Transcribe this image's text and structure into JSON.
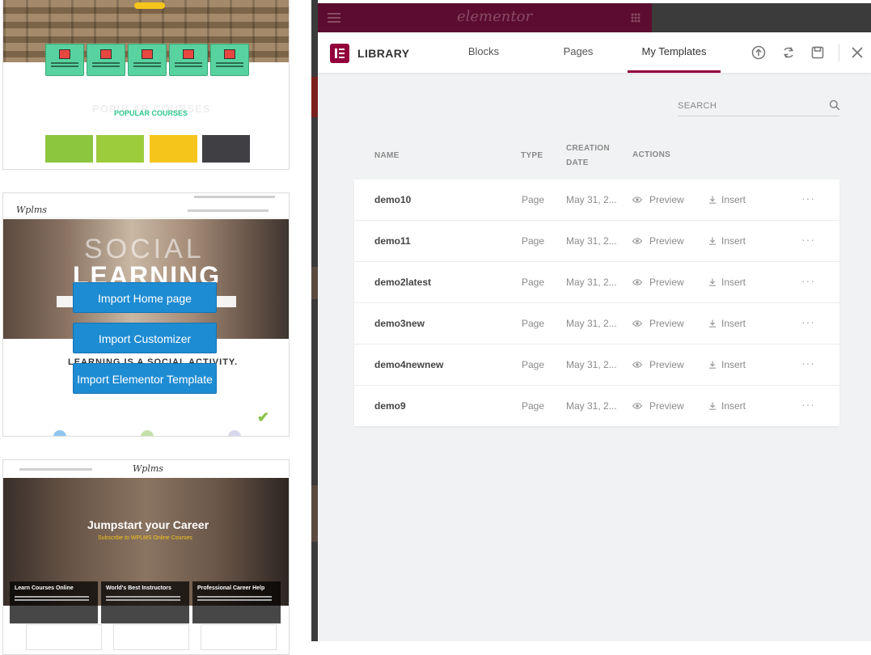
{
  "left_demos": {
    "card1": {
      "popular_ghost": "POPULAR COURSES",
      "popular_label": "POPULAR COURSES"
    },
    "card2": {
      "logo": "Wplms",
      "hero_line1": "SOCIAL",
      "hero_line2": "LEARNING",
      "tagline": "LEARNING IS A SOCIAL ACTIVITY.",
      "buttons": [
        "Import Home page",
        "Import Customizer",
        "Import Elementor Template"
      ]
    },
    "card3": {
      "logo": "Wplms",
      "hero_title": "Jumpstart your Career",
      "hero_sub": "Subscribe to WPLMS Online Courses",
      "boxes": [
        "Learn Courses Online",
        "World's Best Instructors",
        "Professional Career Help"
      ]
    }
  },
  "editor": {
    "logo": "elementor"
  },
  "library": {
    "title": "LIBRARY",
    "tabs": [
      "Blocks",
      "Pages",
      "My Templates"
    ],
    "active_tab": "My Templates",
    "search_placeholder": "SEARCH",
    "columns": {
      "name": "NAME",
      "type": "TYPE",
      "creation_date_line1": "CREATION",
      "creation_date_line2": "DATE",
      "actions": "ACTIONS"
    },
    "preview_label": "Preview",
    "insert_label": "Insert",
    "templates": [
      {
        "name": "demo10",
        "type": "Page",
        "date": "May 31, 2..."
      },
      {
        "name": "demo11",
        "type": "Page",
        "date": "May 31, 2..."
      },
      {
        "name": "demo2latest",
        "type": "Page",
        "date": "May 31, 2..."
      },
      {
        "name": "demo3new",
        "type": "Page",
        "date": "May 31, 2..."
      },
      {
        "name": "demo4newnew",
        "type": "Page",
        "date": "May 31, 2..."
      },
      {
        "name": "demo9",
        "type": "Page",
        "date": "May 31, 2..."
      }
    ],
    "more_glyph": "···",
    "colors": {
      "accent": "#92003b",
      "editor_bar": "#5c0d2f",
      "import_button": "#1e8cd3"
    }
  }
}
